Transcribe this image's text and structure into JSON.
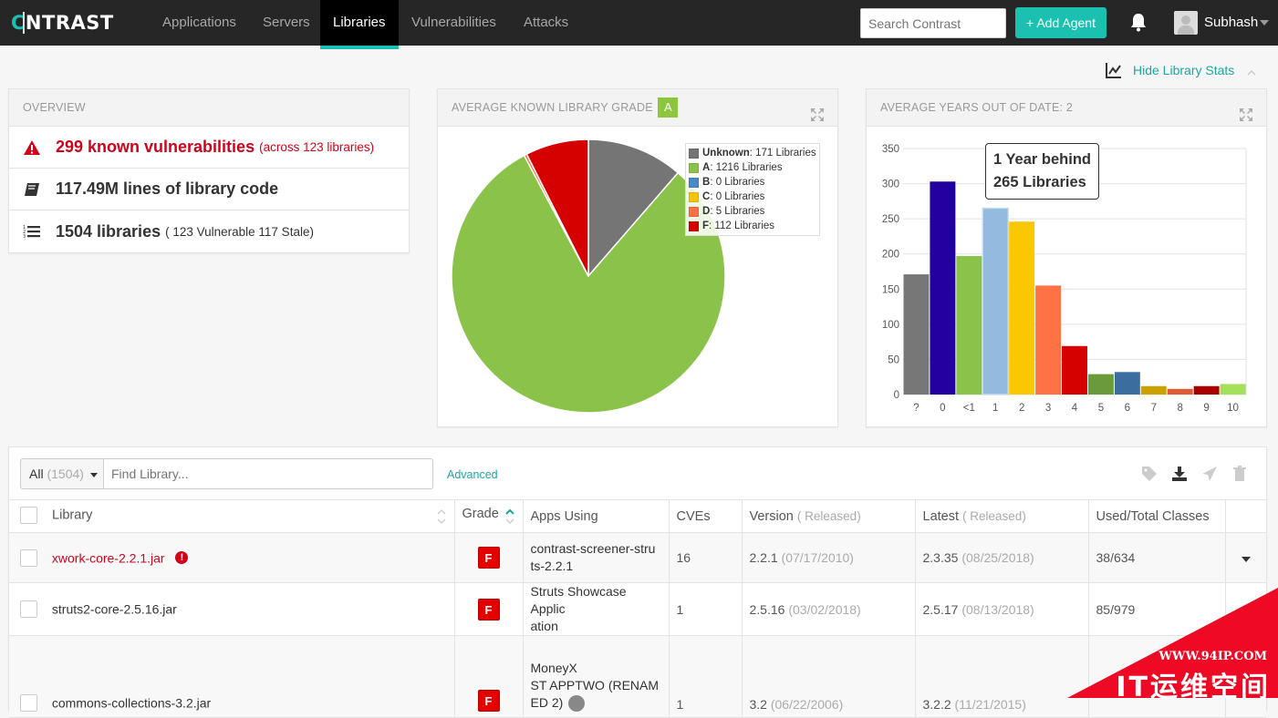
{
  "nav": {
    "logo": {
      "pre": "C",
      "post": "NTRAST"
    },
    "items": [
      {
        "label": "Applications",
        "active": false
      },
      {
        "label": "Servers",
        "active": false
      },
      {
        "label": "Libraries",
        "active": true
      },
      {
        "label": "Vulnerabilities",
        "active": false
      },
      {
        "label": "Attacks",
        "active": false
      }
    ],
    "search_placeholder": "Search Contrast",
    "add_agent_label": "+ Add Agent",
    "user_name": "Subhash"
  },
  "stats_toggle": {
    "label": "Hide Library Stats"
  },
  "overview": {
    "title": "OVERVIEW",
    "rows": [
      {
        "icon": "warning-icon",
        "main": "299 known vulnerabilities",
        "sub": "(across 123 libraries)"
      },
      {
        "icon": "book-icon",
        "main": "117.49M lines of library code",
        "sub": ""
      },
      {
        "icon": "numbered-list-icon",
        "main": "1504 libraries",
        "sub": "( 123 Vulnerable 117 Stale)"
      }
    ]
  },
  "grade_panel": {
    "title": "AVERAGE KNOWN LIBRARY GRADE",
    "grade": "A"
  },
  "years_panel": {
    "title": "AVERAGE YEARS OUT OF DATE: 2",
    "tooltip": {
      "line1": "1 Year behind",
      "line2": "265 Libraries"
    }
  },
  "colors": {
    "accent": "#1bc0b0",
    "danger": "#d0021b",
    "link": "#1ba6a0"
  },
  "chart_data": [
    {
      "type": "pie",
      "title": "AVERAGE KNOWN LIBRARY GRADE",
      "legend_position": "top-right",
      "slices": [
        {
          "label": "Unknown",
          "value": 171,
          "text": "171 Libraries",
          "color": "#757575"
        },
        {
          "label": "A",
          "value": 1216,
          "text": "1216 Libraries",
          "color": "#8bc34a"
        },
        {
          "label": "B",
          "value": 0,
          "text": "0 Libraries",
          "color": "#4a89c8"
        },
        {
          "label": "C",
          "value": 0,
          "text": "0 Libraries",
          "color": "#f5c400"
        },
        {
          "label": "D",
          "value": 5,
          "text": "5 Libraries",
          "color": "#ff7043"
        },
        {
          "label": "F",
          "value": 112,
          "text": "112 Libraries",
          "color": "#d50000"
        }
      ]
    },
    {
      "type": "bar",
      "title": "AVERAGE YEARS OUT OF DATE: 2",
      "xlabel": "",
      "ylabel": "",
      "ylim": [
        0,
        350
      ],
      "yticks": [
        0,
        50,
        100,
        150,
        200,
        250,
        300,
        350
      ],
      "grid": true,
      "categories": [
        "?",
        "0",
        "<1",
        "1",
        "2",
        "3",
        "4",
        "5",
        "6",
        "7",
        "8",
        "9",
        "10"
      ],
      "values": [
        171,
        303,
        197,
        265,
        246,
        155,
        69,
        29,
        32,
        12,
        8,
        12,
        15
      ],
      "colors": [
        "#777777",
        "#2200a0",
        "#8bc34a",
        "#93badf",
        "#f9c800",
        "#ff7245",
        "#d50000",
        "#6a9a3a",
        "#3b6d9e",
        "#c9a100",
        "#e05a35",
        "#a80000",
        "#a4e05a"
      ]
    }
  ],
  "table": {
    "filter": {
      "label": "All",
      "count": "(1504)"
    },
    "search_placeholder": "Find Library...",
    "advanced_label": "Advanced",
    "columns": {
      "library": "Library",
      "grade": "Grade",
      "apps": "Apps Using",
      "cves": "CVEs",
      "version": "Version",
      "version_sub": "( Released)",
      "latest": "Latest",
      "latest_sub": "( Released)",
      "classes": "Used/Total Classes"
    },
    "rows": [
      {
        "name": "xwork-core-2.2.1.jar",
        "vulnerable": true,
        "grade": "F",
        "apps_line1": "contrast-screener-stru",
        "apps_line2": "ts-2.2.1",
        "apps_line3": "",
        "cves": "16",
        "version": "2.2.1",
        "version_date": "(07/17/2010)",
        "latest": "2.3.35",
        "latest_date": "(08/25/2018)",
        "classes": "38/634"
      },
      {
        "name": "struts2-core-2.5.16.jar",
        "vulnerable": false,
        "grade": "F",
        "apps_line1": "Struts Showcase Applic",
        "apps_line2": "ation",
        "apps_line3": "",
        "cves": "1",
        "version": "2.5.16",
        "version_date": "(03/02/2018)",
        "latest": "2.5.17",
        "latest_date": "(08/13/2018)",
        "classes": "85/979"
      },
      {
        "name": "commons-collections-3.2.jar",
        "vulnerable": false,
        "grade": "F",
        "apps_line1": "MoneyX",
        "apps_line2": "ST APPTWO (RENAM",
        "apps_line3": "ED 2)",
        "cves": "1",
        "version": "3.2",
        "version_date": "(06/22/2006)",
        "latest": "3.2.2",
        "latest_date": "(11/21/2015)",
        "classes": ""
      }
    ]
  },
  "watermark": {
    "url": "WWW.94IP.COM",
    "text": "IT运维空间"
  }
}
